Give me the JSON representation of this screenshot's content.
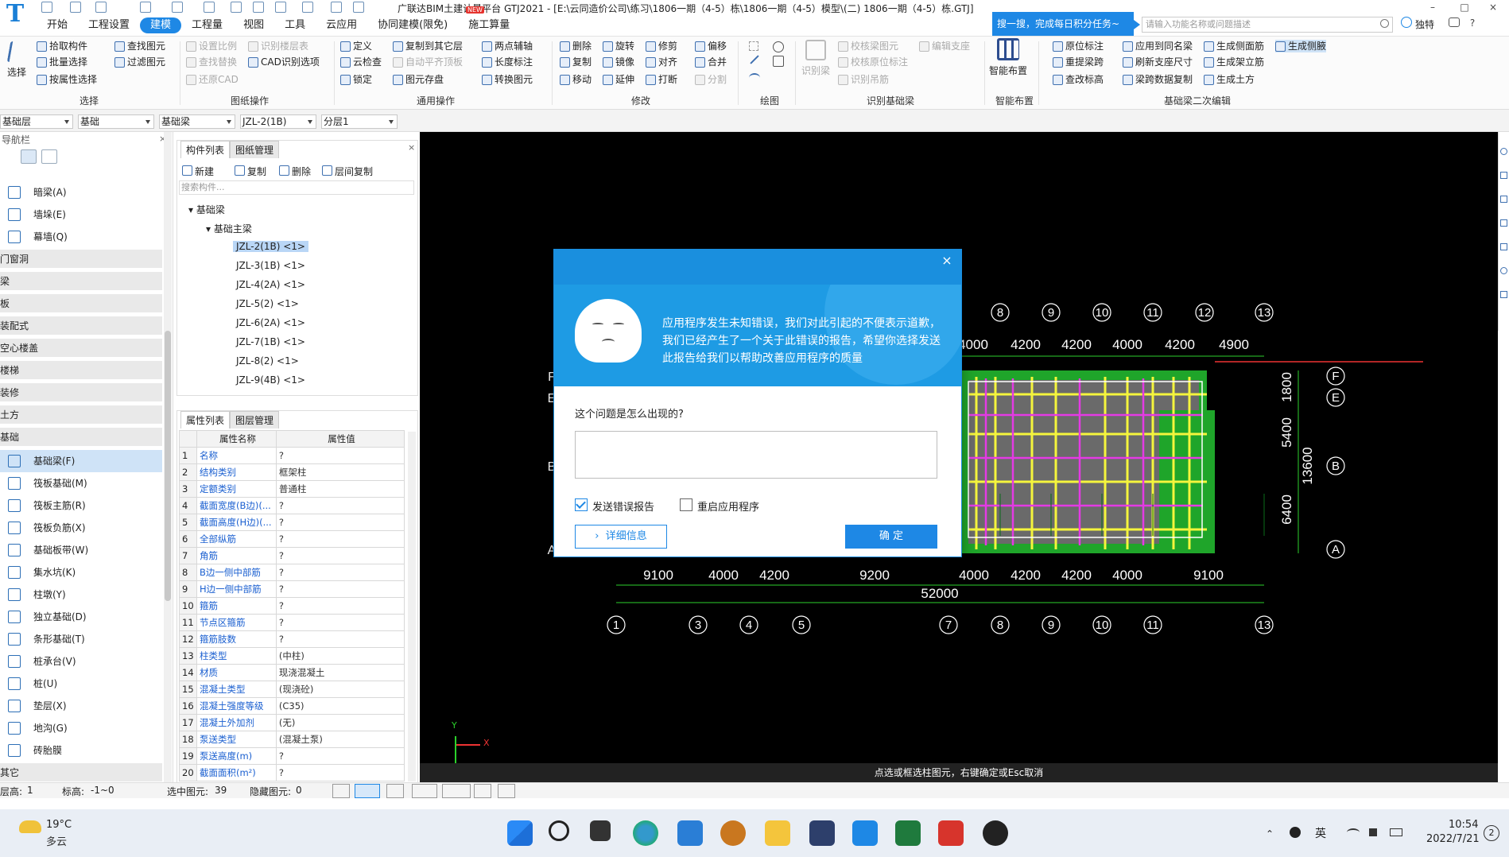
{
  "app": {
    "title": "广联达BIM土建计量平台 GTJ2021 - [E:\\云同造价公司\\练习\\1806一期（4-5）栋\\1806一期（4-5）模型\\(二) 1806一期（4-5）栋.GTJ]",
    "new_badge": "NEW"
  },
  "menu": [
    "开始",
    "工程设置",
    "建模",
    "工程量",
    "视图",
    "工具",
    "云应用",
    "协同建模(限免)",
    "施工算量"
  ],
  "topright": {
    "search_tip": "搜一搜，完成每日积分任务~",
    "search_placeholder": "请输入功能名称或问题描述",
    "user": "独特",
    "window_buttons": [
      "?",
      "–",
      "□",
      "×"
    ]
  },
  "ribbon": {
    "select": {
      "big": "选择",
      "items": [
        "拾取构件",
        "批量选择",
        "按属性选择",
        "查找图元",
        "过滤图元"
      ],
      "group": "选择"
    },
    "drawing_ops": {
      "items": [
        "设置比例",
        "识别楼层表",
        "查找替换",
        "CAD识别选项",
        "还原CAD"
      ],
      "group": "图纸操作"
    },
    "general": {
      "items": [
        "定义",
        "复制到其它层",
        "两点辅轴",
        "云检查",
        "自动平齐顶板",
        "长度标注",
        "锁定",
        "图元存盘",
        "转换图元"
      ],
      "group": "通用操作"
    },
    "modify": {
      "items": [
        "删除",
        "旋转",
        "修剪",
        "偏移",
        "复制",
        "镜像",
        "对齐",
        "合并",
        "移动",
        "延伸",
        "打断",
        "分割"
      ],
      "group": "修改"
    },
    "draw": {
      "group": "绘图"
    },
    "recognize": {
      "big": "识别梁",
      "items": [
        "校核梁图元",
        "编辑支座",
        "校核原位标注",
        "识别吊筋"
      ],
      "group": "识别基础梁"
    },
    "smart": {
      "big": "智能布置",
      "group": "智能布置"
    },
    "secondary": {
      "items": [
        "原位标注",
        "应用到同名梁",
        "生成侧面筋",
        "生成侧腋",
        "重提梁跨",
        "刷新支座尺寸",
        "生成架立筋",
        "查改标高",
        "梁跨数据复制",
        "生成土方"
      ],
      "group": "基础梁二次编辑"
    }
  },
  "filters": [
    "基础层",
    "基础",
    "基础梁",
    "JZL-2(1B)",
    "分层1"
  ],
  "nav": {
    "title": "导航栏",
    "sections": [
      "门窗洞",
      "梁",
      "板",
      "装配式",
      "空心楼盖",
      "楼梯",
      "装修",
      "土方",
      "基础",
      "其它"
    ],
    "wall_items": [
      "暗梁(A)",
      "墙垛(E)",
      "幕墙(Q)"
    ],
    "found_items": [
      "基础梁(F)",
      "筏板基础(M)",
      "筏板主筋(R)",
      "筏板负筋(X)",
      "基础板带(W)",
      "集水坑(K)",
      "柱墩(Y)",
      "独立基础(D)",
      "条形基础(T)",
      "桩承台(V)",
      "桩(U)",
      "垫层(X)",
      "地沟(G)",
      "砖胎膜"
    ]
  },
  "components": {
    "tabs": [
      "构件列表",
      "图纸管理"
    ],
    "tools": [
      "新建",
      "复制",
      "删除",
      "层间复制"
    ],
    "search_placeholder": "搜索构件...",
    "tree_root": "基础梁",
    "tree_sub": "基础主梁",
    "items": [
      "JZL-2(1B) <1>",
      "JZL-3(1B) <1>",
      "JZL-4(2A) <1>",
      "JZL-5(2) <1>",
      "JZL-6(2A) <1>",
      "JZL-7(1B) <1>",
      "JZL-8(2) <1>",
      "JZL-9(4B) <1>"
    ]
  },
  "props": {
    "tabs": [
      "属性列表",
      "图层管理"
    ],
    "col_name": "属性名称",
    "col_value": "属性值",
    "rows": [
      [
        "1",
        "名称",
        "?"
      ],
      [
        "2",
        "结构类别",
        "框架柱"
      ],
      [
        "3",
        "定额类别",
        "普通柱"
      ],
      [
        "4",
        "截面宽度(B边)(...",
        "?"
      ],
      [
        "5",
        "截面高度(H边)(...",
        "?"
      ],
      [
        "6",
        "全部纵筋",
        "?"
      ],
      [
        "7",
        "角筋",
        "?"
      ],
      [
        "8",
        "B边一侧中部筋",
        "?"
      ],
      [
        "9",
        "H边一侧中部筋",
        "?"
      ],
      [
        "10",
        "箍筋",
        "?"
      ],
      [
        "11",
        "节点区箍筋",
        "?"
      ],
      [
        "12",
        "箍筋肢数",
        "?"
      ],
      [
        "13",
        "柱类型",
        "(中柱)"
      ],
      [
        "14",
        "材质",
        "现浇混凝土"
      ],
      [
        "15",
        "混凝土类型",
        "(现浇砼)"
      ],
      [
        "16",
        "混凝土强度等级",
        "(C35)"
      ],
      [
        "17",
        "混凝土外加剂",
        "(无)"
      ],
      [
        "18",
        "泵送类型",
        "(混凝土泵)"
      ],
      [
        "19",
        "泵送高度(m)",
        "?"
      ],
      [
        "20",
        "截面面积(m²)",
        "?"
      ]
    ]
  },
  "drawing": {
    "top_axes": [
      "8",
      "9",
      "10",
      "11",
      "12",
      "13"
    ],
    "top_dims": [
      "4000",
      "4200",
      "4200",
      "4000",
      "4200",
      "4900"
    ],
    "right_axes": [
      "F",
      "E",
      "B",
      "A"
    ],
    "left_axes": [
      "F",
      "E",
      "B",
      "A"
    ],
    "right_dims": [
      "1800",
      "5400",
      "6400",
      "13600"
    ],
    "bottom_dims": [
      "9100",
      "4000",
      "4200",
      "9200",
      "4000",
      "4200",
      "4200",
      "4000",
      "9100"
    ],
    "total": "52000",
    "bottom_axes": [
      "1",
      "3",
      "4",
      "5",
      "7",
      "8",
      "9",
      "10",
      "11",
      "13"
    ],
    "ucs_x": "X",
    "ucs_y": "Y",
    "cmd": "点选或框选柱图元，右键确定或Esc取消"
  },
  "dialog": {
    "message": "应用程序发生未知错误，我们对此引起的不便表示道歉，我们已经产生了一个关于此错误的报告，希望你选择发送此报告给我们以帮助改善应用程序的质量",
    "question": "这个问题是怎么出现的?",
    "check_send": "发送错误报告",
    "check_restart": "重启应用程序",
    "btn_detail": "详细信息",
    "btn_ok": "确  定",
    "close": "×"
  },
  "status": {
    "floor_label": "层高:",
    "floor_val": "1",
    "elev_label": "标高:",
    "elev_val": "-1~0",
    "sel_label": "选中图元:",
    "sel_val": "39",
    "hide_label": "隐藏图元:",
    "hide_val": "0"
  },
  "taskbar": {
    "temp": "19°C",
    "weather": "多云",
    "ime": "英",
    "time": "10:54",
    "date": "2022/7/21",
    "notif": "2"
  }
}
